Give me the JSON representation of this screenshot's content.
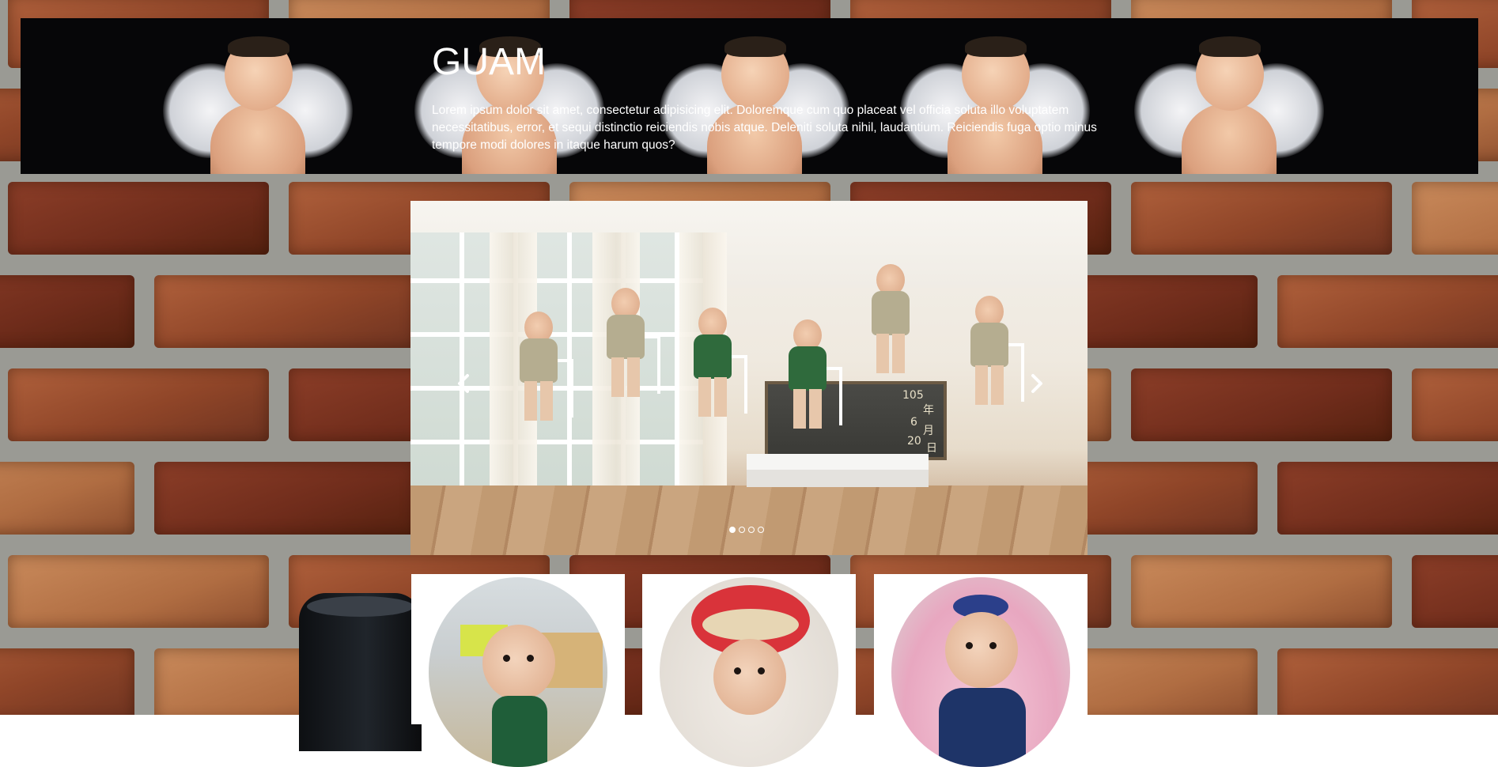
{
  "header": {
    "title": "GUAM",
    "text": "Lorem ipsum dolor sit amet, consectetur adipisicing elit. Doloremque cum quo placeat vel officia soluta illo voluptatem necessitatibus, error, et sequi distinctio reiciendis nobis atque. Deleniti soluta nihil, laudantium. Reiciendis fuga optio minus tempore modi dolores in itaque harum quos?"
  },
  "carousel": {
    "prev_icon": "chevron-left-icon",
    "next_icon": "chevron-right-icon",
    "slide_count": 4,
    "active_index": 0,
    "board_text": [
      "105",
      "年",
      "6",
      "月",
      "20",
      "日"
    ]
  },
  "thumbnails": [
    {
      "name": "baby-photo-1"
    },
    {
      "name": "baby-photo-2"
    },
    {
      "name": "baby-photo-3"
    }
  ],
  "colors": {
    "header_bg": "#060608",
    "brick": "#8f4528",
    "mortar": "#9a9a94"
  }
}
